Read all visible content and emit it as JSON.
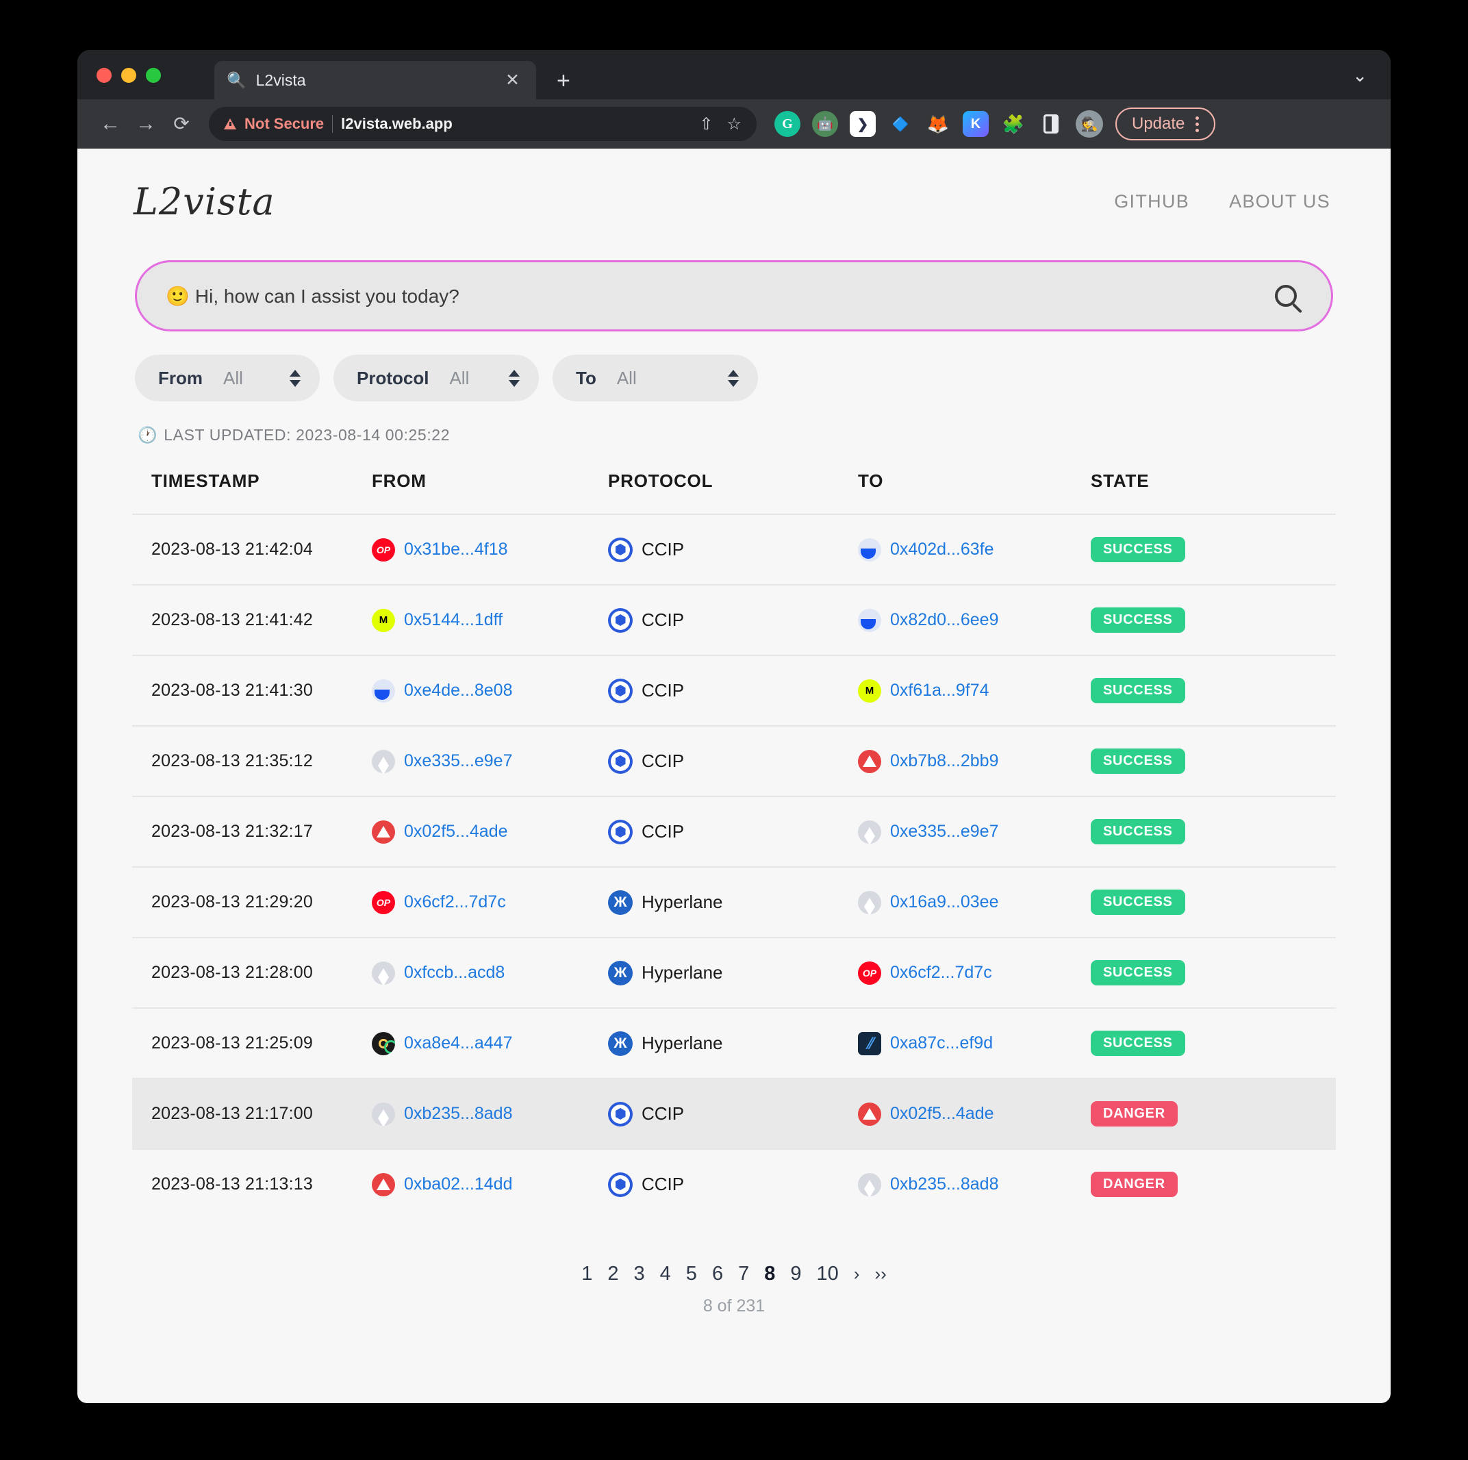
{
  "browser": {
    "tab": {
      "favicon": "🔍",
      "title": "L2vista",
      "close_label": "✕"
    },
    "new_tab_label": "+",
    "tabstrip_chevron": "⌄",
    "nav": {
      "back": "←",
      "forward": "→",
      "reload": "⟳"
    },
    "omnibox": {
      "security_label": "Not Secure",
      "url": "l2vista.web.app",
      "share_icon": "⇧",
      "bookmark_icon": "☆"
    },
    "extensions": [
      {
        "name": "grammarly-extension",
        "glyph": "G"
      },
      {
        "name": "metamask-snaps-extension",
        "glyph": "🤖"
      },
      {
        "name": "phantom-wallet-extension",
        "glyph": "❯"
      },
      {
        "name": "rabby-wallet-extension",
        "glyph": "🔷"
      },
      {
        "name": "metamask-extension",
        "glyph": "🦊"
      },
      {
        "name": "kaito-extension",
        "glyph": "K"
      },
      {
        "name": "extensions-puzzle",
        "glyph": "🧩"
      },
      {
        "name": "side-panel",
        "glyph": ""
      },
      {
        "name": "profile-avatar",
        "glyph": "🕵"
      }
    ],
    "update_button": "Update"
  },
  "header": {
    "logo": "L2vista",
    "nav_links": [
      {
        "label": "GITHUB"
      },
      {
        "label": "ABOUT US"
      }
    ]
  },
  "search": {
    "placeholder": "Hi, how can I assist you today?",
    "emoji": "🙂",
    "border_color": "#e36ee0"
  },
  "filters": [
    {
      "label": "From",
      "value": "All"
    },
    {
      "label": "Protocol",
      "value": "All"
    },
    {
      "label": "To",
      "value": "All"
    }
  ],
  "last_updated": {
    "icon": "🕐",
    "text": "LAST UPDATED: 2023-08-14 00:25:22"
  },
  "table": {
    "columns": [
      "TIMESTAMP",
      "FROM",
      "PROTOCOL",
      "TO",
      "STATE"
    ],
    "rows": [
      {
        "timestamp": "2023-08-13 21:42:04",
        "from_chain": "optimism",
        "from": "0x31be...4f18",
        "protocol": "CCIP",
        "protocol_icon": "ccip",
        "to_chain": "base",
        "to": "0x402d...63fe",
        "state": "SUCCESS",
        "highlight": false
      },
      {
        "timestamp": "2023-08-13 21:41:42",
        "from_chain": "moonbeam",
        "from": "0x5144...1dff",
        "protocol": "CCIP",
        "protocol_icon": "ccip",
        "to_chain": "base",
        "to": "0x82d0...6ee9",
        "state": "SUCCESS",
        "highlight": false
      },
      {
        "timestamp": "2023-08-13 21:41:30",
        "from_chain": "base",
        "from": "0xe4de...8e08",
        "protocol": "CCIP",
        "protocol_icon": "ccip",
        "to_chain": "moonbeam",
        "to": "0xf61a...9f74",
        "state": "SUCCESS",
        "highlight": false
      },
      {
        "timestamp": "2023-08-13 21:35:12",
        "from_chain": "ethereum",
        "from": "0xe335...e9e7",
        "protocol": "CCIP",
        "protocol_icon": "ccip",
        "to_chain": "avalanche",
        "to": "0xb7b8...2bb9",
        "state": "SUCCESS",
        "highlight": false
      },
      {
        "timestamp": "2023-08-13 21:32:17",
        "from_chain": "avalanche",
        "from": "0x02f5...4ade",
        "protocol": "CCIP",
        "protocol_icon": "ccip",
        "to_chain": "ethereum",
        "to": "0xe335...e9e7",
        "state": "SUCCESS",
        "highlight": false
      },
      {
        "timestamp": "2023-08-13 21:29:20",
        "from_chain": "optimism",
        "from": "0x6cf2...7d7c",
        "protocol": "Hyperlane",
        "protocol_icon": "hyperlane",
        "to_chain": "ethereum",
        "to": "0x16a9...03ee",
        "state": "SUCCESS",
        "highlight": false
      },
      {
        "timestamp": "2023-08-13 21:28:00",
        "from_chain": "ethereum",
        "from": "0xfccb...acd8",
        "protocol": "Hyperlane",
        "protocol_icon": "hyperlane",
        "to_chain": "optimism",
        "to": "0x6cf2...7d7c",
        "state": "SUCCESS",
        "highlight": false
      },
      {
        "timestamp": "2023-08-13 21:25:09",
        "from_chain": "celo",
        "from": "0xa8e4...a447",
        "protocol": "Hyperlane",
        "protocol_icon": "hyperlane",
        "to_chain": "arbitrum",
        "to": "0xa87c...ef9d",
        "state": "SUCCESS",
        "highlight": false
      },
      {
        "timestamp": "2023-08-13 21:17:00",
        "from_chain": "ethereum",
        "from": "0xb235...8ad8",
        "protocol": "CCIP",
        "protocol_icon": "ccip",
        "to_chain": "avalanche",
        "to": "0x02f5...4ade",
        "state": "DANGER",
        "highlight": true
      },
      {
        "timestamp": "2023-08-13 21:13:13",
        "from_chain": "avalanche",
        "from": "0xba02...14dd",
        "protocol": "CCIP",
        "protocol_icon": "ccip",
        "to_chain": "ethereum",
        "to": "0xb235...8ad8",
        "state": "DANGER",
        "highlight": false
      }
    ]
  },
  "pagination": {
    "pages": [
      "1",
      "2",
      "3",
      "4",
      "5",
      "6",
      "7",
      "8",
      "9",
      "10"
    ],
    "active": "8",
    "next": "›",
    "last": "››",
    "count_text": "8 of 231"
  },
  "colors": {
    "accent_pink": "#e36ee0",
    "link_blue": "#1f7ae0",
    "success_green": "#2dd08a",
    "danger_red": "#f2516b"
  }
}
